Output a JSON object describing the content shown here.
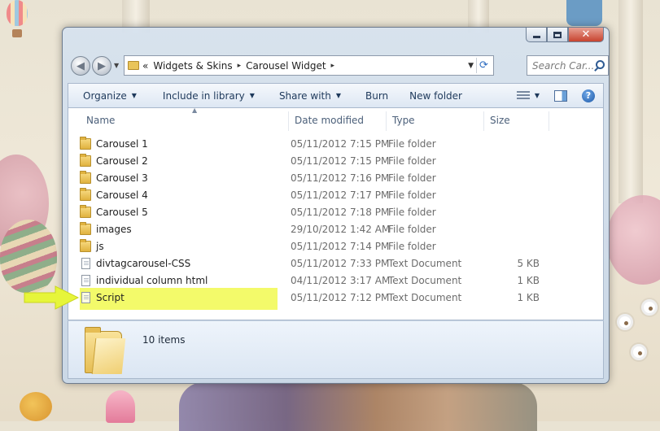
{
  "window": {
    "controls": {
      "minimize": "minimize",
      "maximize": "maximize",
      "close": "close"
    }
  },
  "address": {
    "overflow": "«",
    "crumbs": [
      "Widgets & Skins",
      "Carousel Widget"
    ],
    "separator": "▸"
  },
  "search": {
    "placeholder": "Search Car..."
  },
  "toolbar": {
    "organize": "Organize",
    "include_in_library": "Include in library",
    "share_with": "Share with",
    "burn": "Burn",
    "new_folder": "New folder"
  },
  "columns": {
    "name": "Name",
    "date_modified": "Date modified",
    "type": "Type",
    "size": "Size"
  },
  "files": [
    {
      "name": "Carousel 1",
      "date": "05/11/2012 7:15 PM",
      "type": "File folder",
      "size": "",
      "icon": "folder"
    },
    {
      "name": "Carousel 2",
      "date": "05/11/2012 7:15 PM",
      "type": "File folder",
      "size": "",
      "icon": "folder"
    },
    {
      "name": "Carousel 3",
      "date": "05/11/2012 7:16 PM",
      "type": "File folder",
      "size": "",
      "icon": "folder"
    },
    {
      "name": "Carousel 4",
      "date": "05/11/2012 7:17 PM",
      "type": "File folder",
      "size": "",
      "icon": "folder"
    },
    {
      "name": "Carousel 5",
      "date": "05/11/2012 7:18 PM",
      "type": "File folder",
      "size": "",
      "icon": "folder"
    },
    {
      "name": "images",
      "date": "29/10/2012 1:42 AM",
      "type": "File folder",
      "size": "",
      "icon": "folder"
    },
    {
      "name": "js",
      "date": "05/11/2012 7:14 PM",
      "type": "File folder",
      "size": "",
      "icon": "folder"
    },
    {
      "name": "divtagcarousel-CSS",
      "date": "05/11/2012 7:33 PM",
      "type": "Text Document",
      "size": "5 KB",
      "icon": "document"
    },
    {
      "name": "individual column html",
      "date": "04/11/2012 3:17 AM",
      "type": "Text Document",
      "size": "1 KB",
      "icon": "document"
    },
    {
      "name": "Script",
      "date": "05/11/2012 7:12 PM",
      "type": "Text Document",
      "size": "1 KB",
      "icon": "document",
      "highlighted": true
    }
  ],
  "details": {
    "item_count": "10 items"
  },
  "colors": {
    "highlight": "#f3fa6a",
    "arrow": "#e6f53a",
    "toolbar_text": "#1e395b"
  }
}
